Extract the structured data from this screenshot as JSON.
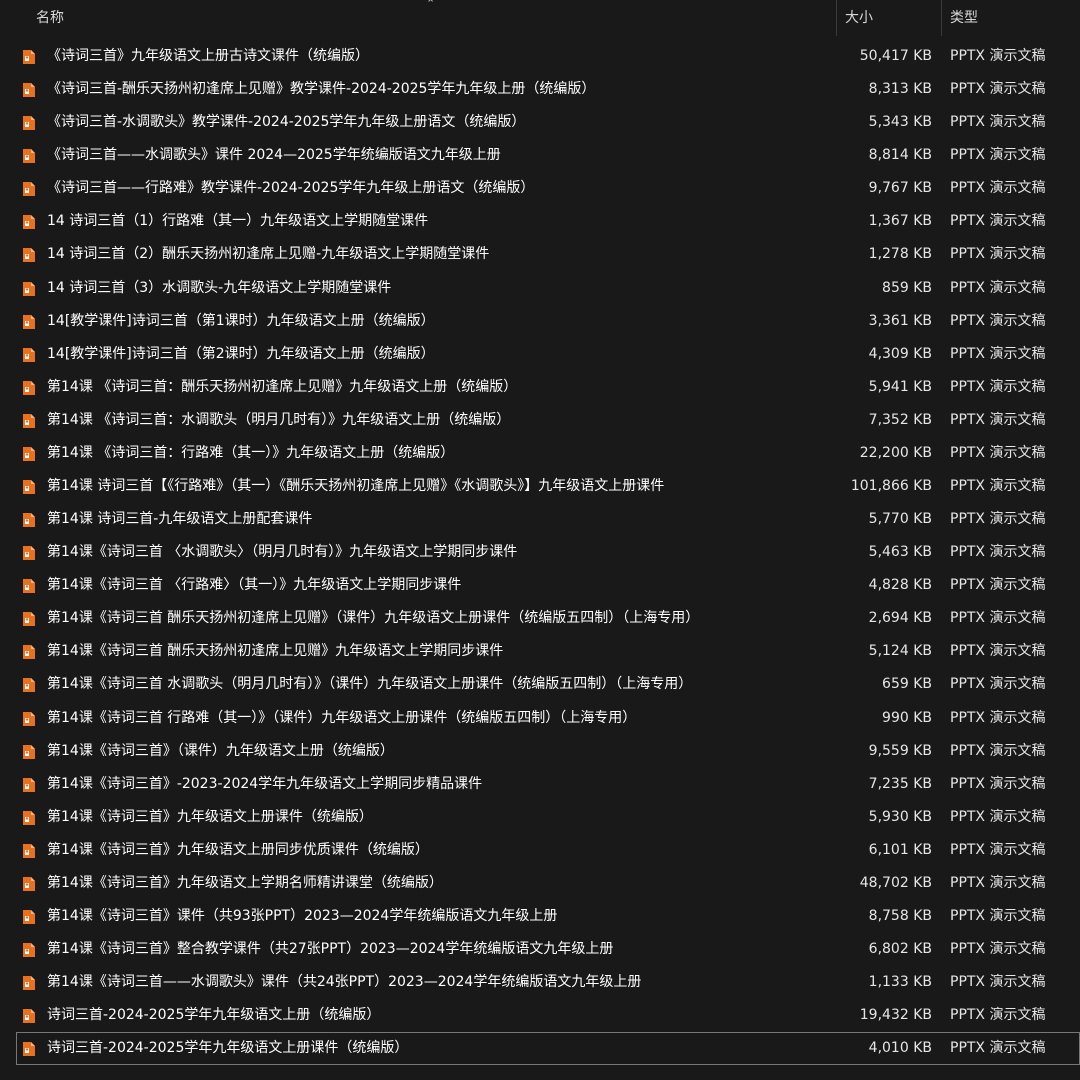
{
  "columns": {
    "name": "名称",
    "size": "大小",
    "type": "类型"
  },
  "icon": {
    "name": "pptx-file-icon",
    "color": "#e8711f"
  },
  "files": [
    {
      "name": "《诗词三首》九年级语文上册古诗文课件（统编版）",
      "size": "50,417 KB",
      "type": "PPTX 演示文稿"
    },
    {
      "name": "《诗词三首-酬乐天扬州初逢席上见赠》教学课件-2024-2025学年九年级上册（统编版）",
      "size": "8,313 KB",
      "type": "PPTX 演示文稿"
    },
    {
      "name": "《诗词三首-水调歌头》教学课件-2024-2025学年九年级上册语文（统编版）",
      "size": "5,343 KB",
      "type": "PPTX 演示文稿"
    },
    {
      "name": "《诗词三首——水调歌头》课件 2024—2025学年统编版语文九年级上册",
      "size": "8,814 KB",
      "type": "PPTX 演示文稿"
    },
    {
      "name": "《诗词三首——行路难》教学课件-2024-2025学年九年级上册语文（统编版）",
      "size": "9,767 KB",
      "type": "PPTX 演示文稿"
    },
    {
      "name": "14 诗词三首（1）行路难（其一）九年级语文上学期随堂课件",
      "size": "1,367 KB",
      "type": "PPTX 演示文稿"
    },
    {
      "name": "14 诗词三首（2）酬乐天扬州初逢席上见赠-九年级语文上学期随堂课件",
      "size": "1,278 KB",
      "type": "PPTX 演示文稿"
    },
    {
      "name": "14 诗词三首（3）水调歌头-九年级语文上学期随堂课件",
      "size": "859 KB",
      "type": "PPTX 演示文稿"
    },
    {
      "name": "14[教学课件]诗词三首（第1课时）九年级语文上册（统编版）",
      "size": "3,361 KB",
      "type": "PPTX 演示文稿"
    },
    {
      "name": "14[教学课件]诗词三首（第2课时）九年级语文上册（统编版）",
      "size": "4,309 KB",
      "type": "PPTX 演示文稿"
    },
    {
      "name": "第14课 《诗词三首：酬乐天扬州初逢席上见赠》九年级语文上册（统编版）",
      "size": "5,941 KB",
      "type": "PPTX 演示文稿"
    },
    {
      "name": "第14课 《诗词三首：水调歌头（明月几时有）》九年级语文上册（统编版）",
      "size": "7,352 KB",
      "type": "PPTX 演示文稿"
    },
    {
      "name": "第14课 《诗词三首：行路难（其一）》九年级语文上册（统编版）",
      "size": "22,200 KB",
      "type": "PPTX 演示文稿"
    },
    {
      "name": "第14课 诗词三首【《行路难》（其一）《酬乐天扬州初逢席上见赠》《水调歌头》】九年级语文上册课件",
      "size": "101,866 KB",
      "type": "PPTX 演示文稿"
    },
    {
      "name": "第14课 诗词三首-九年级语文上册配套课件",
      "size": "5,770 KB",
      "type": "PPTX 演示文稿"
    },
    {
      "name": "第14课《诗词三首 〈水调歌头〉（明月几时有）》九年级语文上学期同步课件",
      "size": "5,463 KB",
      "type": "PPTX 演示文稿"
    },
    {
      "name": "第14课《诗词三首 〈行路难〉（其一）》九年级语文上学期同步课件",
      "size": "4,828 KB",
      "type": "PPTX 演示文稿"
    },
    {
      "name": "第14课《诗词三首 酬乐天扬州初逢席上见赠》（课件）九年级语文上册课件（统编版五四制）（上海专用）",
      "size": "2,694 KB",
      "type": "PPTX 演示文稿"
    },
    {
      "name": "第14课《诗词三首 酬乐天扬州初逢席上见赠》九年级语文上学期同步课件",
      "size": "5,124 KB",
      "type": "PPTX 演示文稿"
    },
    {
      "name": "第14课《诗词三首 水调歌头（明月几时有）》（课件）九年级语文上册课件（统编版五四制）（上海专用）",
      "size": "659 KB",
      "type": "PPTX 演示文稿"
    },
    {
      "name": "第14课《诗词三首 行路难（其一）》（课件）九年级语文上册课件（统编版五四制）（上海专用）",
      "size": "990 KB",
      "type": "PPTX 演示文稿"
    },
    {
      "name": "第14课《诗词三首》（课件）九年级语文上册（统编版）",
      "size": "9,559 KB",
      "type": "PPTX 演示文稿"
    },
    {
      "name": "第14课《诗词三首》-2023-2024学年九年级语文上学期同步精品课件",
      "size": "7,235 KB",
      "type": "PPTX 演示文稿"
    },
    {
      "name": "第14课《诗词三首》九年级语文上册课件（统编版）",
      "size": "5,930 KB",
      "type": "PPTX 演示文稿"
    },
    {
      "name": "第14课《诗词三首》九年级语文上册同步优质课件（统编版）",
      "size": "6,101 KB",
      "type": "PPTX 演示文稿"
    },
    {
      "name": "第14课《诗词三首》九年级语文上学期名师精讲课堂（统编版）",
      "size": "48,702 KB",
      "type": "PPTX 演示文稿"
    },
    {
      "name": "第14课《诗词三首》课件（共93张PPT）2023—2024学年统编版语文九年级上册",
      "size": "8,758 KB",
      "type": "PPTX 演示文稿"
    },
    {
      "name": "第14课《诗词三首》整合教学课件（共27张PPT）2023—2024学年统编版语文九年级上册",
      "size": "6,802 KB",
      "type": "PPTX 演示文稿"
    },
    {
      "name": "第14课《诗词三首——水调歌头》课件（共24张PPT）2023—2024学年统编版语文九年级上册",
      "size": "1,133 KB",
      "type": "PPTX 演示文稿"
    },
    {
      "name": "诗词三首-2024-2025学年九年级语文上册（统编版）",
      "size": "19,432 KB",
      "type": "PPTX 演示文稿"
    },
    {
      "name": "诗词三首-2024-2025学年九年级语文上册课件（统编版）",
      "size": "4,010 KB",
      "type": "PPTX 演示文稿",
      "selected": true
    }
  ]
}
